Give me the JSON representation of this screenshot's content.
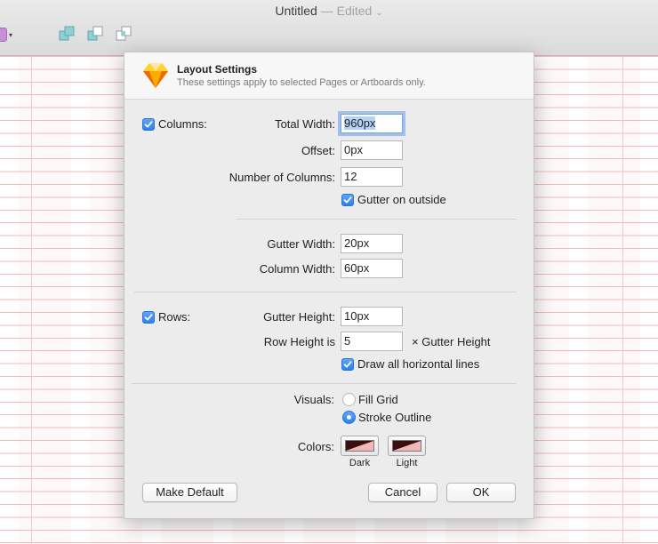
{
  "window": {
    "title": "Untitled",
    "status": "— Edited",
    "status_chevron": "⌄"
  },
  "toolbar": {
    "style_menu_chevron": "▾",
    "icons": [
      "union-icon",
      "subtract-icon",
      "intersect-icon"
    ]
  },
  "dialog": {
    "title": "Layout Settings",
    "subtitle": "These settings apply to selected Pages or Artboards only.",
    "columns": {
      "label": "Columns:",
      "checked": true,
      "total_width_label": "Total Width:",
      "total_width_value": "960px",
      "offset_label": "Offset:",
      "offset_value": "0px",
      "num_columns_label": "Number of Columns:",
      "num_columns_value": "12",
      "gutter_outside_label": "Gutter on outside",
      "gutter_outside_checked": true,
      "gutter_width_label": "Gutter Width:",
      "gutter_width_value": "20px",
      "column_width_label": "Column Width:",
      "column_width_value": "60px"
    },
    "rows": {
      "label": "Rows:",
      "checked": true,
      "gutter_height_label": "Gutter Height:",
      "gutter_height_value": "10px",
      "row_height_label": "Row Height is",
      "row_height_value": "5",
      "row_height_suffix": "× Gutter Height",
      "draw_lines_label": "Draw all horizontal lines",
      "draw_lines_checked": true
    },
    "visuals": {
      "label": "Visuals:",
      "options": [
        "Fill Grid",
        "Stroke Outline"
      ],
      "selected": "Stroke Outline"
    },
    "colors": {
      "label": "Colors:",
      "dark_caption": "Dark",
      "light_caption": "Light",
      "dark_color": "#3a0f10",
      "accent_color": "#f2b8b9"
    },
    "buttons": {
      "make_default": "Make Default",
      "cancel": "Cancel",
      "ok": "OK"
    }
  },
  "colors": {
    "accent": "#2e7ff0",
    "grid_line": "#f4b4b8",
    "sketch_orange": "#f5a623"
  }
}
